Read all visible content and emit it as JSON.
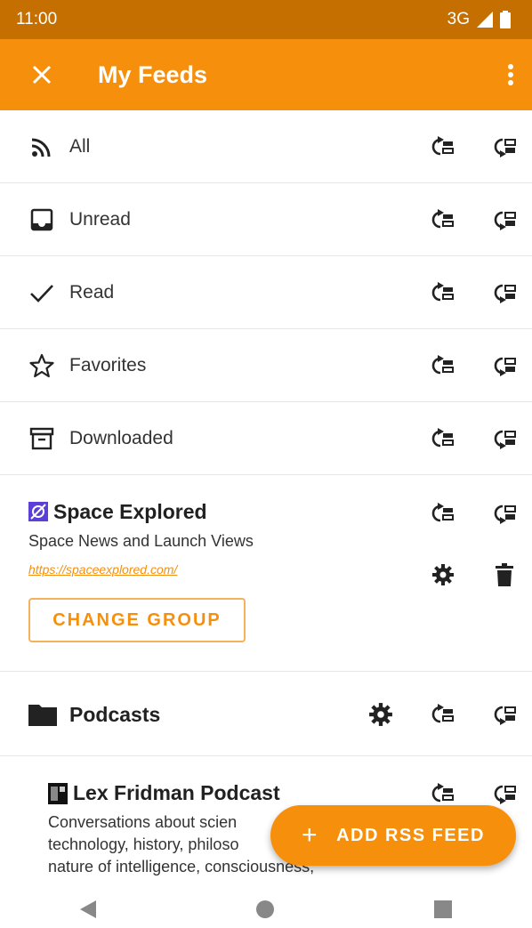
{
  "status": {
    "time": "11:00",
    "network": "3G"
  },
  "appbar": {
    "title": "My Feeds"
  },
  "items": [
    {
      "label": "All",
      "icon": "rss-icon"
    },
    {
      "label": "Unread",
      "icon": "inbox-icon"
    },
    {
      "label": "Read",
      "icon": "check-icon"
    },
    {
      "label": "Favorites",
      "icon": "star-icon"
    },
    {
      "label": "Downloaded",
      "icon": "archive-icon"
    }
  ],
  "feed": {
    "title": "Space Explored",
    "description": "Space News and Launch Views",
    "link": "https://spaceexplored.com/",
    "change_group": "CHANGE GROUP"
  },
  "group": {
    "label": "Podcasts"
  },
  "podcast": {
    "title": "Lex Fridman Podcast",
    "desc_line1": "Conversations about scien",
    "desc_line2": "technology, history, philoso",
    "desc_line3": "nature of intelligence, consciousness,"
  },
  "fab": {
    "label": "ADD RSS FEED"
  },
  "colors": {
    "primary": "#f6900c",
    "status": "#c46f00"
  }
}
